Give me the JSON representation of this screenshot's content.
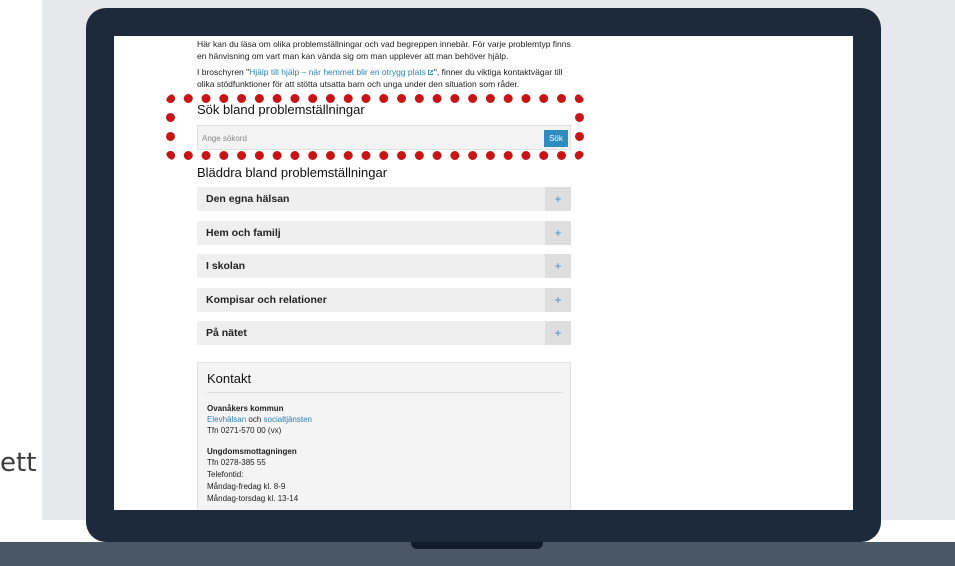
{
  "background_text": "ett",
  "page": {
    "intro_paragraph": "Här kan du läsa om olika problemställningar och vad begreppen innebär. För varje problemtyp finns en hänvisning om vart man kan vända sig om man upplever att man behöver hjälp.",
    "brochure_paragraph": {
      "prefix": "I broschyren \"",
      "link_text": "Hjälp till hjälp – när hemmet blir en otrygg plats",
      "link_icon": "external-link-icon",
      "suffix": "\", finner du viktiga kontaktvägar till olika stödfunktioner för att stötta utsatta barn och unga under den situation som råder."
    }
  },
  "search": {
    "heading": "Sök bland problemställningar",
    "placeholder": "Ange sökord",
    "button_label": "Sök"
  },
  "browse": {
    "heading": "Bläddra bland problemställningar",
    "items": [
      {
        "label": "Den egna hälsan",
        "toggle": "+"
      },
      {
        "label": "Hem och familj",
        "toggle": "+"
      },
      {
        "label": "I skolan",
        "toggle": "+"
      },
      {
        "label": "Kompisar och relationer",
        "toggle": "+"
      },
      {
        "label": "På nätet",
        "toggle": "+"
      }
    ]
  },
  "contact": {
    "title": "Kontakt",
    "org1_name": "Ovanåkers kommun",
    "org1_link1": "Elevhälsan",
    "org1_and": "och",
    "org1_link2": "socialtjänsten",
    "org1_phone": "Tfn 0271-570 00 (vx)",
    "org2_name": "Ungdomsmottagningen",
    "org2_phone": "Tfn 0278-385 55",
    "org2_hours_label": "Telefontid:",
    "org2_hours_1": "Måndag-fredag kl. 8-9",
    "org2_hours_2": "Måndag-torsdag kl. 13-14"
  },
  "colors": {
    "highlight": "#c81414",
    "accent": "#2d8dbf",
    "laptop_frame": "#1c2a3b"
  }
}
